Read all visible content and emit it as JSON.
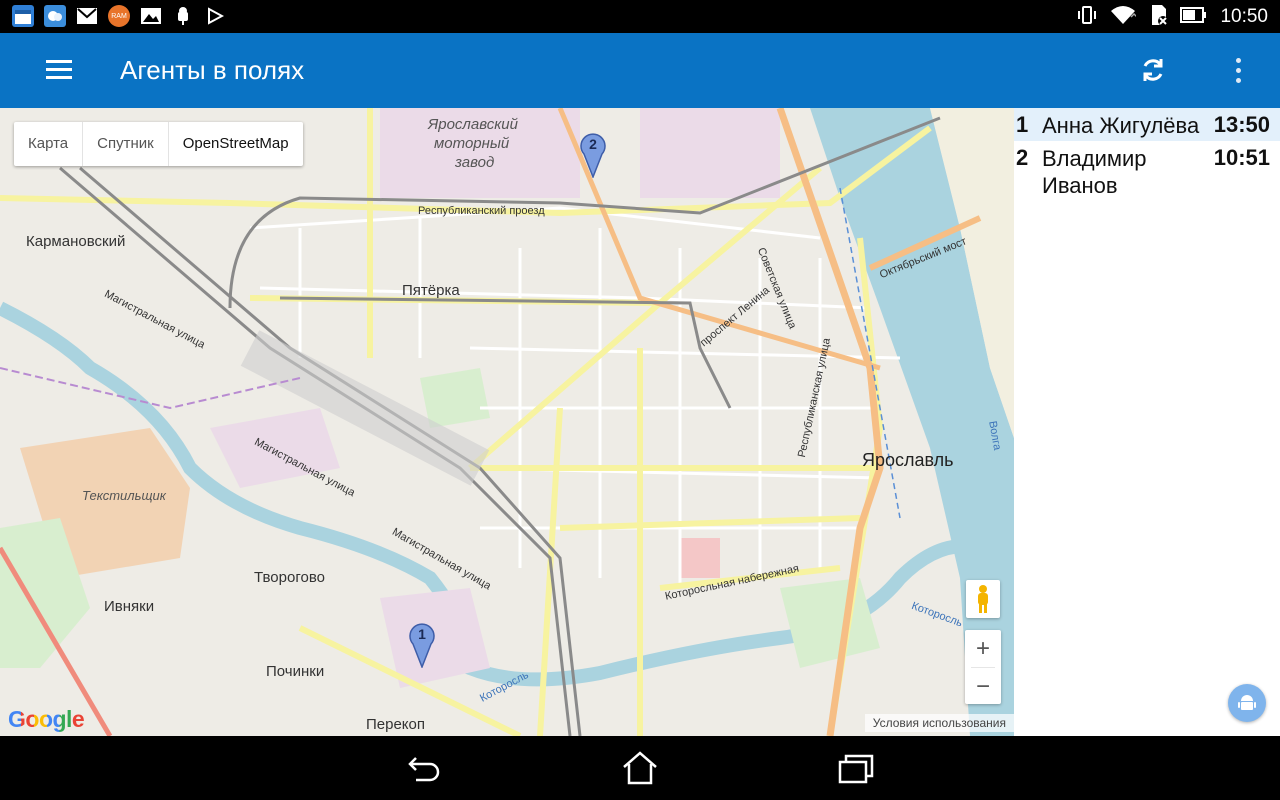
{
  "status_bar": {
    "time": "10:50",
    "left_icons": [
      "calendar-icon",
      "weather-icon",
      "gmail-icon",
      "ram-app-icon",
      "gallery-icon",
      "android-debug-icon",
      "play-store-icon"
    ],
    "ram_label": "RAM",
    "right_icons": [
      "vibrate-icon",
      "wifi-icon",
      "sd-card-icon",
      "battery-icon"
    ]
  },
  "app_bar": {
    "title": "Агенты в полях",
    "bg_color": "#0a73c4"
  },
  "map": {
    "type_buttons": [
      "Карта",
      "Спутник",
      "OpenStreetMap"
    ],
    "active_type": "OpenStreetMap",
    "labels": {
      "motor_plant_1": "Ярославский",
      "motor_plant_2": "моторный",
      "motor_plant_3": "завод",
      "karmanovsky": "Кармановский",
      "pyaterka": "Пятёрка",
      "yaroslavl": "Ярославль",
      "tekstilshchik": "Текстильщик",
      "tvorogovo": "Творогово",
      "ivnyaki": "Ивняки",
      "pochinki": "Починки",
      "perekop": "Перекоп",
      "republican_passage": "Республиканский проезд",
      "magistralnaya_1": "Магистральная улица",
      "magistralnaya_2": "Магистральная улица",
      "magistralnaya_3": "Магистральная улица",
      "lenin_ave": "проспект Ленина",
      "sovetskaya": "Советская улица",
      "oktyabrsky": "Октябрьский мост",
      "respublikanskaya": "Республиканская улица",
      "kotorosl_emb": "Которосльная набережная",
      "kotorosl_1": "Которосль",
      "kotorosl_2": "Которосль",
      "volga": "Волга",
      "kotorosl_partial": "Ко"
    },
    "markers": [
      {
        "number": "2"
      },
      {
        "number": "1"
      }
    ],
    "zoom_in": "+",
    "zoom_out": "−",
    "logo": "Google",
    "terms": "Условия использования"
  },
  "agents": [
    {
      "index": "1",
      "name": "Анна Жигулёва",
      "time": "13:50",
      "selected": true
    },
    {
      "index": "2",
      "name": "Владимир Иванов",
      "time": "10:51",
      "selected": false
    }
  ],
  "nav_icons": [
    "back-icon",
    "home-icon",
    "recents-icon"
  ]
}
